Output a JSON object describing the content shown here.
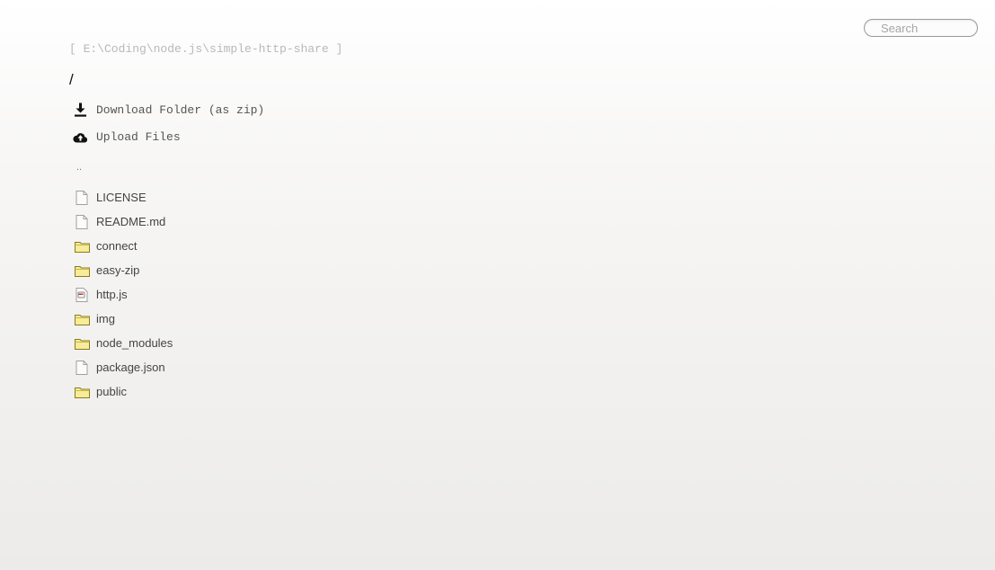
{
  "search": {
    "placeholder": "Search",
    "icon": "search-input"
  },
  "header": {
    "path": "[ E:\\Coding\\node.js\\simple-http-share ]",
    "breadcrumb": "/"
  },
  "actions": {
    "download_label": "Download Folder (as zip)",
    "download_icon": "download-icon",
    "upload_label": "Upload Files",
    "upload_icon": "cloud-upload-icon"
  },
  "listing": {
    "parent": "..",
    "items": [
      {
        "name": "LICENSE",
        "type": "file"
      },
      {
        "name": "README.md",
        "type": "file"
      },
      {
        "name": "connect",
        "type": "folder"
      },
      {
        "name": "easy-zip",
        "type": "folder"
      },
      {
        "name": "http.js",
        "type": "script"
      },
      {
        "name": "img",
        "type": "folder"
      },
      {
        "name": "node_modules",
        "type": "folder"
      },
      {
        "name": "package.json",
        "type": "file"
      },
      {
        "name": "public",
        "type": "folder"
      }
    ]
  },
  "colors": {
    "folder_fill": "#f6ec9a",
    "folder_stroke": "#8c7a1e",
    "file_stroke": "#a0a0a0",
    "script_accent": "#c0392b",
    "path_text": "#b8b8b8"
  }
}
